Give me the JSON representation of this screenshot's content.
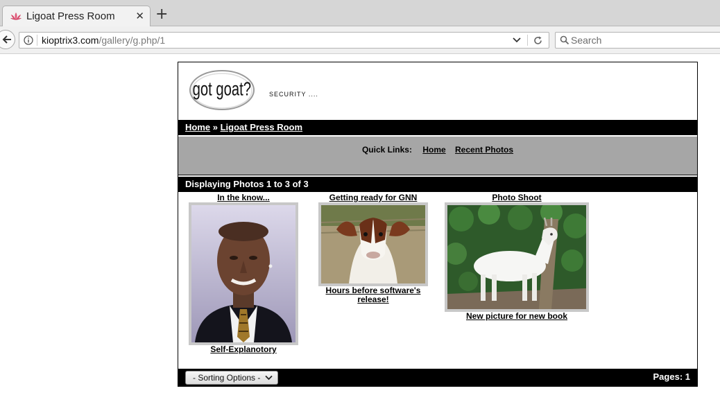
{
  "browser": {
    "tab_title": "Ligoat Press Room",
    "tab_close": "✕",
    "new_tab": "+",
    "url_host": "kioptrix3.com",
    "url_path": "/gallery/g.php/1",
    "search_placeholder": "Search"
  },
  "header": {
    "logo_text": "got goat?",
    "tagline": "SECURITY ...."
  },
  "breadcrumb": {
    "home": "Home",
    "separator": " » ",
    "current": "Ligoat Press Room"
  },
  "quick_links": {
    "label": "Quick Links:",
    "home": "Home",
    "recent": "Recent Photos"
  },
  "displaying": "Displaying Photos 1 to 3 of 3",
  "photos": [
    {
      "title": "In the know...",
      "caption": "Self-Explanotory",
      "icon": "portrait-man"
    },
    {
      "title": "Getting ready for GNN",
      "caption": "Hours before software's release!",
      "icon": "goat-closeup"
    },
    {
      "title": "Photo Shoot",
      "caption": "New picture for new book",
      "icon": "white-goat"
    }
  ],
  "footer": {
    "sort_label": "- Sorting Options -",
    "pages": "Pages: 1"
  },
  "colors": {
    "bar_black": "#000000",
    "quicklinks_gray": "#a6a6a6",
    "frame_gray": "#c8c8c8"
  }
}
